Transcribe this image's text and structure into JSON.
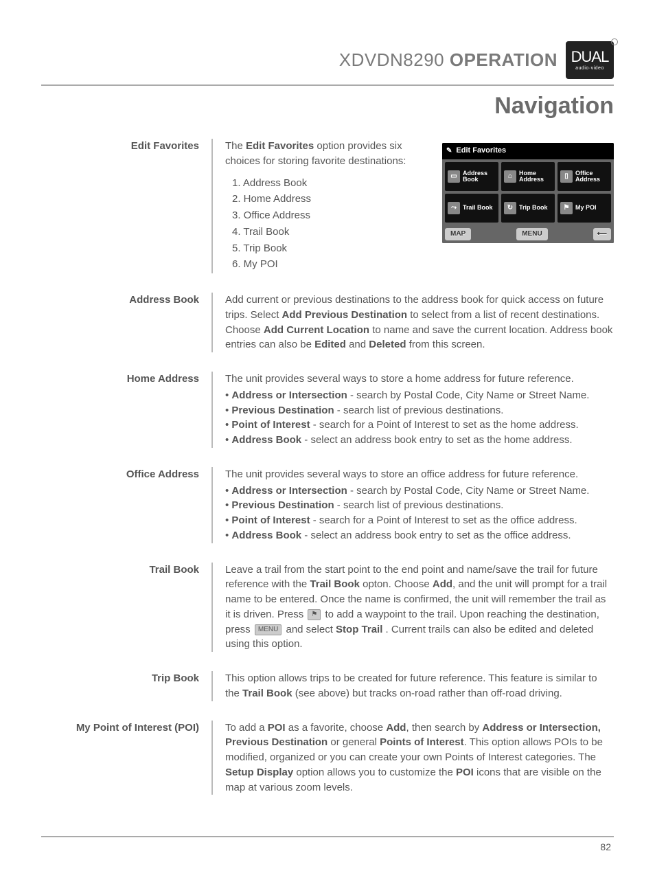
{
  "header": {
    "model": "XDVDN8290",
    "operation": "OPERATION",
    "logo_word": "DUAL",
    "logo_sub": "audio·video"
  },
  "section_title": "Navigation",
  "page_number": "82",
  "screenshot": {
    "title": "Edit Favorites",
    "cells": [
      "Address Book",
      "Home Address",
      "Office Address",
      "Trail Book",
      "Trip Book",
      "My POI"
    ],
    "btn_map": "MAP",
    "btn_menu": "MENU",
    "btn_back": "⟵"
  },
  "rows": {
    "edit_fav": {
      "label": "Edit Favorites",
      "intro_pre": "The ",
      "intro_bold": "Edit Favorites",
      "intro_post": " option provides six choices for storing favorite destinations:",
      "list": [
        "1. Address Book",
        "2. Home Address",
        "3. Office Address",
        "4. Trail Book",
        "5. Trip Book",
        "6. My POI"
      ]
    },
    "addr_book": {
      "label": "Address Book",
      "t1": "Add current or previous destinations to the address book for quick access on future trips. Select ",
      "b1": "Add Previous Destination",
      "t2": " to select from a list of recent destinations. Choose ",
      "b2": "Add Current Location",
      "t3": " to name and save the current location. Address book entries can also be ",
      "b3": "Edited",
      "t4": " and ",
      "b4": "Deleted",
      "t5": " from this screen."
    },
    "home_addr": {
      "label": "Home Address",
      "intro": "The unit provides several ways to store a home address for future reference.",
      "bul": [
        {
          "b": "Address or Intersection",
          "t": " - search by Postal Code, City Name or Street Name."
        },
        {
          "b": "Previous Destination",
          "t": " - search list of previous destinations."
        },
        {
          "b": "Point of Interest",
          "t": " - search for a Point of Interest to set as the home address."
        },
        {
          "b": "Address Book",
          "t": " - select an address book entry to set as the home address."
        }
      ]
    },
    "office_addr": {
      "label": "Office Address",
      "intro": "The unit provides several ways to store an office address for future reference.",
      "bul": [
        {
          "b": "Address or Intersection",
          "t": " - search by Postal Code, City Name or Street Name."
        },
        {
          "b": "Previous Destination",
          "t": " - search list of previous destinations."
        },
        {
          "b": "Point of Interest",
          "t": " - search for a Point of Interest to set as the office address."
        },
        {
          "b": "Address Book",
          "t": " - select an address book entry to set as the office address."
        }
      ]
    },
    "trail_book": {
      "label": "Trail Book",
      "t1": "Leave a trail from the start point to the end point and name/save the trail for future reference with the ",
      "b1": "Trail Book",
      "t2": " opton. Choose ",
      "b2": "Add",
      "t3": ", and the unit will prompt for a trail name to be entered. Once the name is confirmed, the unit will remember the trail as it is driven. Press ",
      "icon1": "⚑",
      "t4": " to add a waypoint to the trail. Upon reaching the destination, press ",
      "icon2": "MENU",
      "t5": " and select ",
      "b3": "Stop Trail",
      "t6": " . Current trails can also be edited and deleted using this option."
    },
    "trip_book": {
      "label": "Trip Book",
      "t1": "This option allows trips to be created for future reference. This feature is similar to the ",
      "b1": "Trail Book",
      "t2": " (see above) but tracks on-road rather than off-road driving."
    },
    "poi": {
      "label": "My Point of Interest (POI)",
      "t1": "To add a ",
      "b1": "POI",
      "t2": " as a favorite, choose ",
      "b2": "Add",
      "t3": ", then search by ",
      "b3": "Address or Intersection, Previous Destination",
      "t4": " or general ",
      "b4": "Points of Interest",
      "t5": ". This option allows POIs to be modified, organized or you can create your own Points of Interest categories. The ",
      "b5": "Setup Display",
      "t6": " option allows you to customize the ",
      "b6": "POI",
      "t7": " icons that are visible on the map at various zoom levels."
    }
  }
}
